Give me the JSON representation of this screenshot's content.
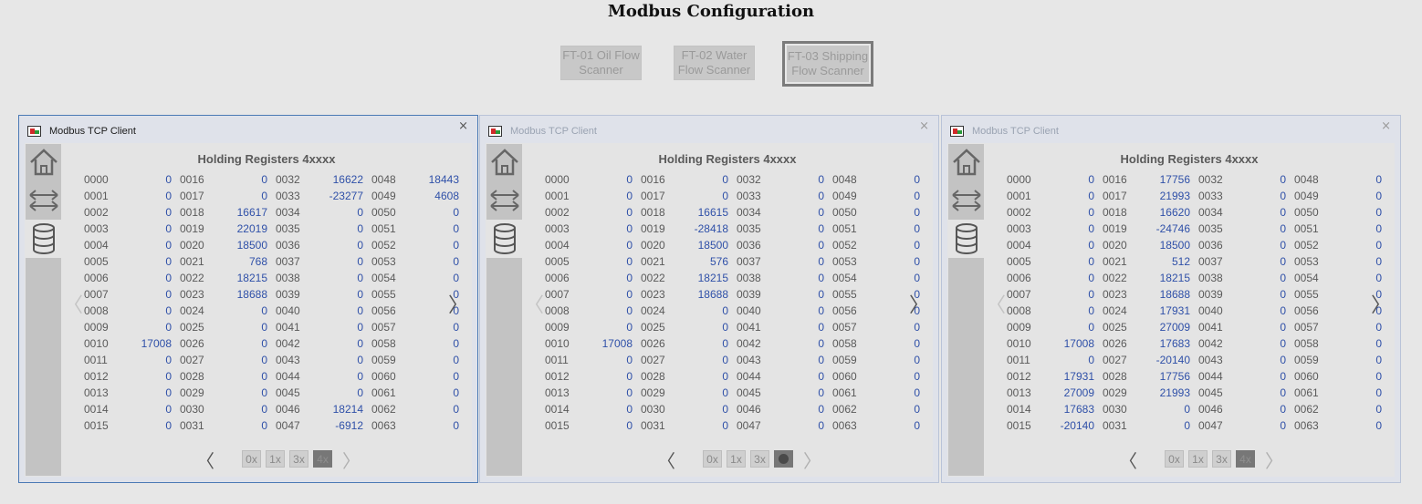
{
  "page_title": "Modbus Configuration",
  "scanners": [
    {
      "label": "FT-01 Oil Flow Scanner",
      "active": false
    },
    {
      "label": "FT-02 Water Flow Scanner",
      "active": false
    },
    {
      "label": "FT-03 Shipping Flow Scanner",
      "active": true
    }
  ],
  "colors": {
    "value_text": "#2f50a8",
    "active_border": "#4a79b5",
    "background": "#e7e7e7"
  },
  "icons": {
    "home": "home-icon",
    "transfer": "transfer-arrows-icon",
    "database": "database-icon",
    "close": "close-icon"
  },
  "clients": [
    {
      "title": "Modbus TCP Client",
      "close": "×",
      "table_title": "Holding Registers 4xxxx",
      "nav_prev": "〈",
      "nav_next": "〉",
      "pager": {
        "prev": "〈",
        "next": "〉",
        "modes": [
          "0x",
          "1x",
          "3x",
          "4x"
        ],
        "selected": "4x"
      },
      "columns": [
        {
          "addr": [
            "0000",
            "0001",
            "0002",
            "0003",
            "0004",
            "0005",
            "0006",
            "0007",
            "0008",
            "0009",
            "0010",
            "0011",
            "0012",
            "0013",
            "0014",
            "0015"
          ],
          "vals": [
            "0",
            "0",
            "0",
            "0",
            "0",
            "0",
            "0",
            "0",
            "0",
            "0",
            "17008",
            "0",
            "0",
            "0",
            "0",
            "0"
          ]
        },
        {
          "addr": [
            "0016",
            "0017",
            "0018",
            "0019",
            "0020",
            "0021",
            "0022",
            "0023",
            "0024",
            "0025",
            "0026",
            "0027",
            "0028",
            "0029",
            "0030",
            "0031"
          ],
          "vals": [
            "0",
            "0",
            "16617",
            "22019",
            "18500",
            "768",
            "18215",
            "18688",
            "0",
            "0",
            "0",
            "0",
            "0",
            "0",
            "0",
            "0"
          ]
        },
        {
          "addr": [
            "0032",
            "0033",
            "0034",
            "0035",
            "0036",
            "0037",
            "0038",
            "0039",
            "0040",
            "0041",
            "0042",
            "0043",
            "0044",
            "0045",
            "0046",
            "0047"
          ],
          "vals": [
            "16622",
            "-23277",
            "0",
            "0",
            "0",
            "0",
            "0",
            "0",
            "0",
            "0",
            "0",
            "0",
            "0",
            "0",
            "18214",
            "-6912"
          ]
        },
        {
          "addr": [
            "0048",
            "0049",
            "0050",
            "0051",
            "0052",
            "0053",
            "0054",
            "0055",
            "0056",
            "0057",
            "0058",
            "0059",
            "0060",
            "0061",
            "0062",
            "0063"
          ],
          "vals": [
            "18443",
            "4608",
            "0",
            "0",
            "0",
            "0",
            "0",
            "0",
            "0",
            "0",
            "0",
            "0",
            "0",
            "0",
            "0",
            "0"
          ]
        }
      ]
    },
    {
      "title": "Modbus TCP Client",
      "close": "×",
      "table_title": "Holding Registers 4xxxx",
      "nav_prev": "〈",
      "nav_next": "〉",
      "pager": {
        "prev": "〈",
        "next": "〉",
        "modes": [
          "0x",
          "1x",
          "3x",
          "4x"
        ],
        "selected": "4x"
      },
      "columns": [
        {
          "addr": [
            "0000",
            "0001",
            "0002",
            "0003",
            "0004",
            "0005",
            "0006",
            "0007",
            "0008",
            "0009",
            "0010",
            "0011",
            "0012",
            "0013",
            "0014",
            "0015"
          ],
          "vals": [
            "0",
            "0",
            "0",
            "0",
            "0",
            "0",
            "0",
            "0",
            "0",
            "0",
            "17008",
            "0",
            "0",
            "0",
            "0",
            "0"
          ]
        },
        {
          "addr": [
            "0016",
            "0017",
            "0018",
            "0019",
            "0020",
            "0021",
            "0022",
            "0023",
            "0024",
            "0025",
            "0026",
            "0027",
            "0028",
            "0029",
            "0030",
            "0031"
          ],
          "vals": [
            "0",
            "0",
            "16615",
            "-28418",
            "18500",
            "576",
            "18215",
            "18688",
            "0",
            "0",
            "0",
            "0",
            "0",
            "0",
            "0",
            "0"
          ]
        },
        {
          "addr": [
            "0032",
            "0033",
            "0034",
            "0035",
            "0036",
            "0037",
            "0038",
            "0039",
            "0040",
            "0041",
            "0042",
            "0043",
            "0044",
            "0045",
            "0046",
            "0047"
          ],
          "vals": [
            "0",
            "0",
            "0",
            "0",
            "0",
            "0",
            "0",
            "0",
            "0",
            "0",
            "0",
            "0",
            "0",
            "0",
            "0",
            "0"
          ]
        },
        {
          "addr": [
            "0048",
            "0049",
            "0050",
            "0051",
            "0052",
            "0053",
            "0054",
            "0055",
            "0056",
            "0057",
            "0058",
            "0059",
            "0060",
            "0061",
            "0062",
            "0063"
          ],
          "vals": [
            "0",
            "0",
            "0",
            "0",
            "0",
            "0",
            "0",
            "0",
            "0",
            "0",
            "0",
            "0",
            "0",
            "0",
            "0",
            "0"
          ]
        }
      ]
    },
    {
      "title": "Modbus TCP Client",
      "close": "×",
      "table_title": "Holding Registers 4xxxx",
      "nav_prev": "〈",
      "nav_next": "〉",
      "pager": {
        "prev": "〈",
        "next": "〉",
        "modes": [
          "0x",
          "1x",
          "3x",
          "4x"
        ],
        "selected": "4x"
      },
      "columns": [
        {
          "addr": [
            "0000",
            "0001",
            "0002",
            "0003",
            "0004",
            "0005",
            "0006",
            "0007",
            "0008",
            "0009",
            "0010",
            "0011",
            "0012",
            "0013",
            "0014",
            "0015"
          ],
          "vals": [
            "0",
            "0",
            "0",
            "0",
            "0",
            "0",
            "0",
            "0",
            "0",
            "0",
            "17008",
            "0",
            "17931",
            "27009",
            "17683",
            "-20140"
          ]
        },
        {
          "addr": [
            "0016",
            "0017",
            "0018",
            "0019",
            "0020",
            "0021",
            "0022",
            "0023",
            "0024",
            "0025",
            "0026",
            "0027",
            "0028",
            "0029",
            "0030",
            "0031"
          ],
          "vals": [
            "17756",
            "21993",
            "16620",
            "-24746",
            "18500",
            "512",
            "18215",
            "18688",
            "17931",
            "27009",
            "17683",
            "-20140",
            "17756",
            "21993",
            "0",
            "0"
          ]
        },
        {
          "addr": [
            "0032",
            "0033",
            "0034",
            "0035",
            "0036",
            "0037",
            "0038",
            "0039",
            "0040",
            "0041",
            "0042",
            "0043",
            "0044",
            "0045",
            "0046",
            "0047"
          ],
          "vals": [
            "0",
            "0",
            "0",
            "0",
            "0",
            "0",
            "0",
            "0",
            "0",
            "0",
            "0",
            "0",
            "0",
            "0",
            "0",
            "0"
          ]
        },
        {
          "addr": [
            "0048",
            "0049",
            "0050",
            "0051",
            "0052",
            "0053",
            "0054",
            "0055",
            "0056",
            "0057",
            "0058",
            "0059",
            "0060",
            "0061",
            "0062",
            "0063"
          ],
          "vals": [
            "0",
            "0",
            "0",
            "0",
            "0",
            "0",
            "0",
            "0",
            "0",
            "0",
            "0",
            "0",
            "0",
            "0",
            "0",
            "0"
          ]
        }
      ]
    }
  ]
}
